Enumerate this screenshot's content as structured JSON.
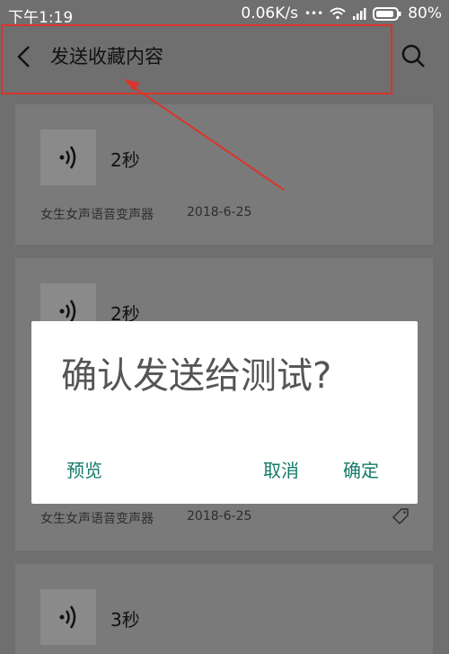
{
  "status_bar": {
    "time": "下午1:19",
    "network_speed": "0.06K/s",
    "dots": "•••",
    "battery": "80%"
  },
  "header": {
    "title": "发送收藏内容"
  },
  "items": [
    {
      "duration": "2秒",
      "source": "女生女声语音变声器",
      "date": "2018-6-25"
    },
    {
      "duration": "2秒",
      "source": "女生女声语音变声器",
      "date": "2018-6-25"
    },
    {
      "duration": "3秒"
    }
  ],
  "dialog": {
    "message": "确认发送给测试?",
    "preview": "预览",
    "cancel": "取消",
    "confirm": "确定"
  },
  "colors": {
    "accent": "#137a68",
    "annotation": "#d9352b",
    "overlay": "#6f6f6f"
  }
}
